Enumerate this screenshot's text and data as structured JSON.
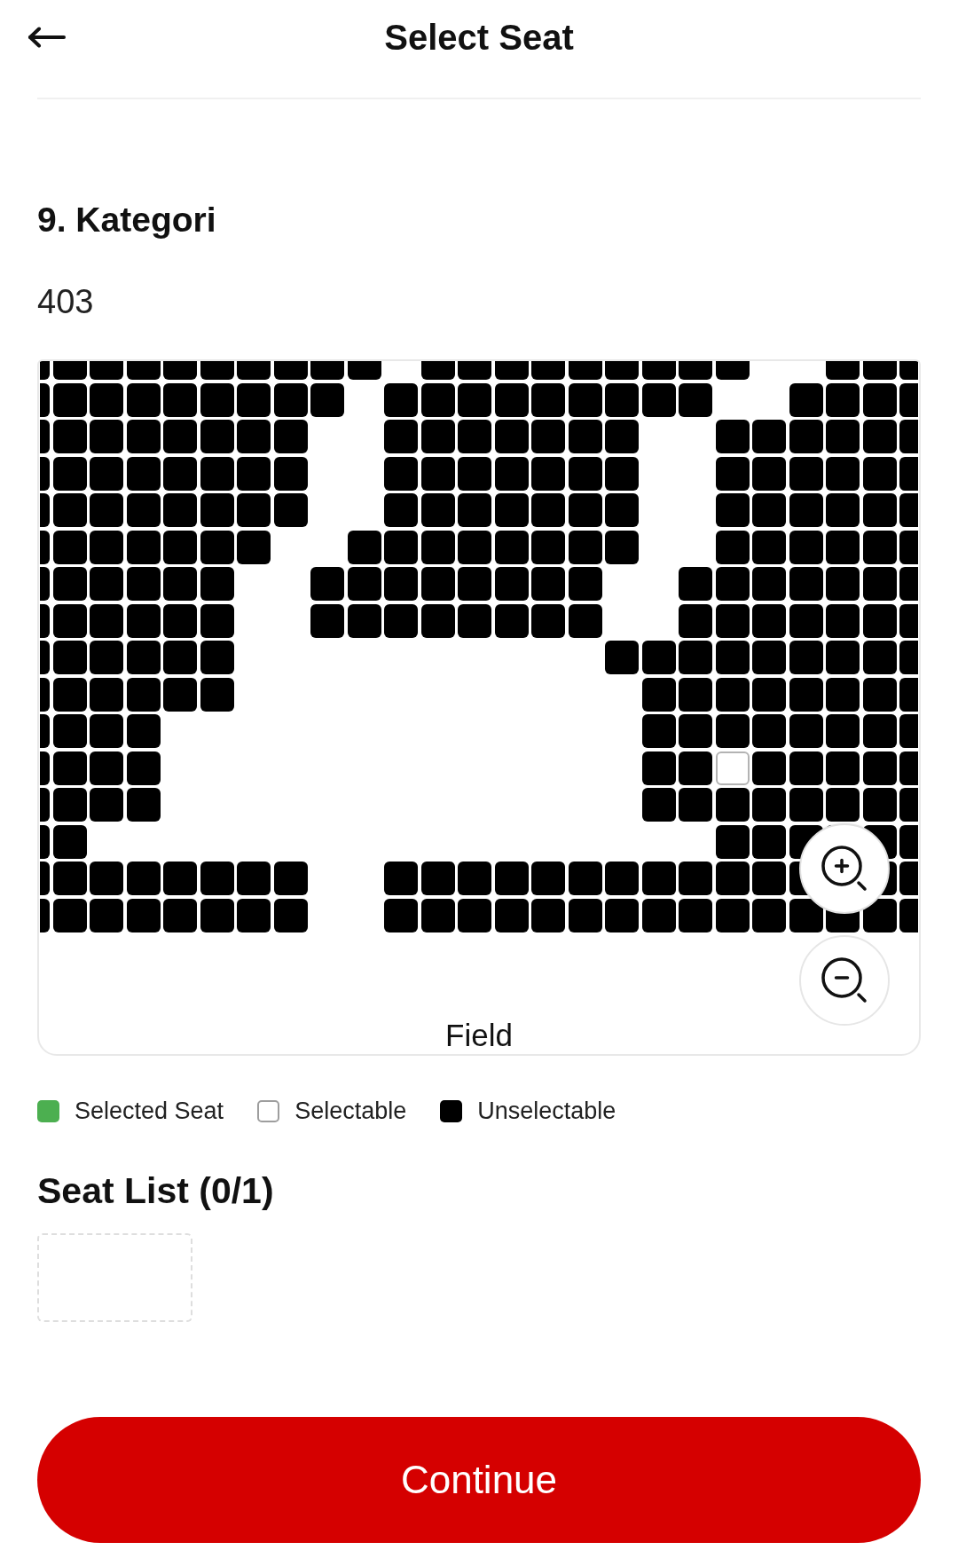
{
  "header": {
    "title": "Select Seat"
  },
  "category": {
    "title": "9. Kategori",
    "section": "403"
  },
  "seat_map": {
    "field_label": "Field",
    "rows": [
      {
        "seats": [
          {
            "kind": "blocked"
          },
          {
            "kind": "blocked"
          },
          {
            "kind": "blocked"
          },
          {
            "kind": "blocked"
          },
          {
            "kind": "blocked"
          },
          {
            "kind": "blocked"
          },
          {
            "kind": "blocked"
          },
          {
            "kind": "blocked"
          },
          {
            "kind": "blocked"
          },
          {
            "kind": "blocked"
          },
          {
            "kind": "gap"
          },
          {
            "kind": "blocked"
          },
          {
            "kind": "blocked"
          },
          {
            "kind": "blocked"
          },
          {
            "kind": "blocked"
          },
          {
            "kind": "blocked"
          },
          {
            "kind": "blocked"
          },
          {
            "kind": "blocked"
          },
          {
            "kind": "blocked"
          },
          {
            "kind": "blocked"
          },
          {
            "kind": "gap"
          },
          {
            "kind": "gap"
          },
          {
            "kind": "blocked"
          },
          {
            "kind": "blocked"
          },
          {
            "kind": "blocked"
          }
        ]
      },
      {
        "seats": [
          {
            "kind": "blocked"
          },
          {
            "kind": "blocked"
          },
          {
            "kind": "blocked"
          },
          {
            "kind": "blocked"
          },
          {
            "kind": "blocked"
          },
          {
            "kind": "blocked"
          },
          {
            "kind": "blocked"
          },
          {
            "kind": "blocked"
          },
          {
            "kind": "blocked"
          },
          {
            "kind": "gap"
          },
          {
            "kind": "blocked"
          },
          {
            "kind": "blocked"
          },
          {
            "kind": "blocked"
          },
          {
            "kind": "blocked"
          },
          {
            "kind": "blocked"
          },
          {
            "kind": "blocked"
          },
          {
            "kind": "blocked"
          },
          {
            "kind": "blocked"
          },
          {
            "kind": "blocked"
          },
          {
            "kind": "gap"
          },
          {
            "kind": "gap"
          },
          {
            "kind": "blocked"
          },
          {
            "kind": "blocked"
          },
          {
            "kind": "blocked"
          },
          {
            "kind": "blocked"
          }
        ]
      },
      {
        "seats": [
          {
            "kind": "blocked"
          },
          {
            "kind": "blocked"
          },
          {
            "kind": "blocked"
          },
          {
            "kind": "blocked"
          },
          {
            "kind": "blocked"
          },
          {
            "kind": "blocked"
          },
          {
            "kind": "blocked"
          },
          {
            "kind": "blocked"
          },
          {
            "kind": "gap"
          },
          {
            "kind": "gap"
          },
          {
            "kind": "blocked"
          },
          {
            "kind": "blocked"
          },
          {
            "kind": "blocked"
          },
          {
            "kind": "blocked"
          },
          {
            "kind": "blocked"
          },
          {
            "kind": "blocked"
          },
          {
            "kind": "blocked"
          },
          {
            "kind": "gap"
          },
          {
            "kind": "gap"
          },
          {
            "kind": "blocked"
          },
          {
            "kind": "blocked"
          },
          {
            "kind": "blocked"
          },
          {
            "kind": "blocked"
          },
          {
            "kind": "blocked"
          },
          {
            "kind": "blocked"
          }
        ]
      },
      {
        "seats": [
          {
            "kind": "blocked"
          },
          {
            "kind": "blocked"
          },
          {
            "kind": "blocked"
          },
          {
            "kind": "blocked"
          },
          {
            "kind": "blocked"
          },
          {
            "kind": "blocked"
          },
          {
            "kind": "blocked"
          },
          {
            "kind": "blocked"
          },
          {
            "kind": "gap"
          },
          {
            "kind": "gap"
          },
          {
            "kind": "blocked"
          },
          {
            "kind": "blocked"
          },
          {
            "kind": "blocked"
          },
          {
            "kind": "blocked"
          },
          {
            "kind": "blocked"
          },
          {
            "kind": "blocked"
          },
          {
            "kind": "blocked"
          },
          {
            "kind": "gap"
          },
          {
            "kind": "gap"
          },
          {
            "kind": "blocked"
          },
          {
            "kind": "blocked"
          },
          {
            "kind": "blocked"
          },
          {
            "kind": "blocked"
          },
          {
            "kind": "blocked"
          },
          {
            "kind": "blocked"
          }
        ]
      },
      {
        "seats": [
          {
            "kind": "blocked"
          },
          {
            "kind": "blocked"
          },
          {
            "kind": "blocked"
          },
          {
            "kind": "blocked"
          },
          {
            "kind": "blocked"
          },
          {
            "kind": "blocked"
          },
          {
            "kind": "blocked"
          },
          {
            "kind": "blocked"
          },
          {
            "kind": "gap"
          },
          {
            "kind": "gap"
          },
          {
            "kind": "blocked"
          },
          {
            "kind": "blocked"
          },
          {
            "kind": "blocked"
          },
          {
            "kind": "blocked"
          },
          {
            "kind": "blocked"
          },
          {
            "kind": "blocked"
          },
          {
            "kind": "blocked"
          },
          {
            "kind": "gap"
          },
          {
            "kind": "gap"
          },
          {
            "kind": "blocked"
          },
          {
            "kind": "blocked"
          },
          {
            "kind": "blocked"
          },
          {
            "kind": "blocked"
          },
          {
            "kind": "blocked"
          },
          {
            "kind": "blocked"
          }
        ]
      },
      {
        "seats": [
          {
            "kind": "blocked"
          },
          {
            "kind": "blocked"
          },
          {
            "kind": "blocked"
          },
          {
            "kind": "blocked"
          },
          {
            "kind": "blocked"
          },
          {
            "kind": "blocked"
          },
          {
            "kind": "blocked"
          },
          {
            "kind": "gap"
          },
          {
            "kind": "gap"
          },
          {
            "kind": "blocked"
          },
          {
            "kind": "blocked"
          },
          {
            "kind": "blocked"
          },
          {
            "kind": "blocked"
          },
          {
            "kind": "blocked"
          },
          {
            "kind": "blocked"
          },
          {
            "kind": "blocked"
          },
          {
            "kind": "blocked"
          },
          {
            "kind": "gap"
          },
          {
            "kind": "gap"
          },
          {
            "kind": "blocked"
          },
          {
            "kind": "blocked"
          },
          {
            "kind": "blocked"
          },
          {
            "kind": "blocked"
          },
          {
            "kind": "blocked"
          },
          {
            "kind": "blocked"
          }
        ]
      },
      {
        "seats": [
          {
            "kind": "blocked"
          },
          {
            "kind": "blocked"
          },
          {
            "kind": "blocked"
          },
          {
            "kind": "blocked"
          },
          {
            "kind": "blocked"
          },
          {
            "kind": "blocked"
          },
          {
            "kind": "gap"
          },
          {
            "kind": "gap"
          },
          {
            "kind": "blocked"
          },
          {
            "kind": "blocked"
          },
          {
            "kind": "blocked"
          },
          {
            "kind": "blocked"
          },
          {
            "kind": "blocked"
          },
          {
            "kind": "blocked"
          },
          {
            "kind": "blocked"
          },
          {
            "kind": "blocked"
          },
          {
            "kind": "gap"
          },
          {
            "kind": "gap"
          },
          {
            "kind": "blocked"
          },
          {
            "kind": "blocked"
          },
          {
            "kind": "blocked"
          },
          {
            "kind": "blocked"
          },
          {
            "kind": "blocked"
          },
          {
            "kind": "blocked"
          },
          {
            "kind": "blocked"
          }
        ]
      },
      {
        "seats": [
          {
            "kind": "blocked"
          },
          {
            "kind": "blocked"
          },
          {
            "kind": "blocked"
          },
          {
            "kind": "blocked"
          },
          {
            "kind": "blocked"
          },
          {
            "kind": "blocked"
          },
          {
            "kind": "gap"
          },
          {
            "kind": "gap"
          },
          {
            "kind": "blocked"
          },
          {
            "kind": "blocked"
          },
          {
            "kind": "blocked"
          },
          {
            "kind": "blocked"
          },
          {
            "kind": "blocked"
          },
          {
            "kind": "blocked"
          },
          {
            "kind": "blocked"
          },
          {
            "kind": "blocked"
          },
          {
            "kind": "gap"
          },
          {
            "kind": "gap"
          },
          {
            "kind": "blocked"
          },
          {
            "kind": "blocked"
          },
          {
            "kind": "blocked"
          },
          {
            "kind": "blocked"
          },
          {
            "kind": "blocked"
          },
          {
            "kind": "blocked"
          },
          {
            "kind": "blocked"
          }
        ]
      },
      {
        "seats": [
          {
            "kind": "blocked"
          },
          {
            "kind": "blocked"
          },
          {
            "kind": "blocked"
          },
          {
            "kind": "blocked"
          },
          {
            "kind": "blocked"
          },
          {
            "kind": "blocked"
          },
          {
            "kind": "gap"
          },
          {
            "kind": "gap"
          },
          {
            "kind": "gap"
          },
          {
            "kind": "gap"
          },
          {
            "kind": "gap"
          },
          {
            "kind": "gap"
          },
          {
            "kind": "gap"
          },
          {
            "kind": "gap"
          },
          {
            "kind": "gap"
          },
          {
            "kind": "gap"
          },
          {
            "kind": "blocked"
          },
          {
            "kind": "blocked"
          },
          {
            "kind": "blocked"
          },
          {
            "kind": "blocked"
          },
          {
            "kind": "blocked"
          },
          {
            "kind": "blocked"
          },
          {
            "kind": "blocked"
          },
          {
            "kind": "blocked"
          },
          {
            "kind": "blocked"
          }
        ]
      },
      {
        "seats": [
          {
            "kind": "blocked"
          },
          {
            "kind": "blocked"
          },
          {
            "kind": "blocked"
          },
          {
            "kind": "blocked"
          },
          {
            "kind": "blocked"
          },
          {
            "kind": "blocked"
          },
          {
            "kind": "gap"
          },
          {
            "kind": "gap"
          },
          {
            "kind": "gap"
          },
          {
            "kind": "gap"
          },
          {
            "kind": "gap"
          },
          {
            "kind": "gap"
          },
          {
            "kind": "gap"
          },
          {
            "kind": "gap"
          },
          {
            "kind": "gap"
          },
          {
            "kind": "gap"
          },
          {
            "kind": "gap"
          },
          {
            "kind": "blocked"
          },
          {
            "kind": "blocked"
          },
          {
            "kind": "blocked"
          },
          {
            "kind": "blocked"
          },
          {
            "kind": "blocked"
          },
          {
            "kind": "blocked"
          },
          {
            "kind": "blocked"
          },
          {
            "kind": "blocked"
          }
        ]
      },
      {
        "seats": [
          {
            "kind": "blocked"
          },
          {
            "kind": "blocked"
          },
          {
            "kind": "blocked"
          },
          {
            "kind": "blocked"
          },
          {
            "kind": "gap"
          },
          {
            "kind": "gap"
          },
          {
            "kind": "gap"
          },
          {
            "kind": "gap"
          },
          {
            "kind": "gap"
          },
          {
            "kind": "gap"
          },
          {
            "kind": "gap"
          },
          {
            "kind": "gap"
          },
          {
            "kind": "gap"
          },
          {
            "kind": "gap"
          },
          {
            "kind": "gap"
          },
          {
            "kind": "gap"
          },
          {
            "kind": "gap"
          },
          {
            "kind": "blocked"
          },
          {
            "kind": "blocked"
          },
          {
            "kind": "blocked"
          },
          {
            "kind": "blocked"
          },
          {
            "kind": "blocked"
          },
          {
            "kind": "blocked"
          },
          {
            "kind": "blocked"
          },
          {
            "kind": "blocked"
          }
        ]
      },
      {
        "seats": [
          {
            "kind": "blocked"
          },
          {
            "kind": "blocked"
          },
          {
            "kind": "blocked"
          },
          {
            "kind": "blocked"
          },
          {
            "kind": "gap"
          },
          {
            "kind": "gap"
          },
          {
            "kind": "gap"
          },
          {
            "kind": "gap"
          },
          {
            "kind": "gap"
          },
          {
            "kind": "gap"
          },
          {
            "kind": "gap"
          },
          {
            "kind": "gap"
          },
          {
            "kind": "gap"
          },
          {
            "kind": "gap"
          },
          {
            "kind": "gap"
          },
          {
            "kind": "gap"
          },
          {
            "kind": "gap"
          },
          {
            "kind": "blocked"
          },
          {
            "kind": "blocked"
          },
          {
            "kind": "open"
          },
          {
            "kind": "blocked"
          },
          {
            "kind": "blocked"
          },
          {
            "kind": "blocked"
          },
          {
            "kind": "blocked"
          },
          {
            "kind": "blocked"
          }
        ]
      },
      {
        "seats": [
          {
            "kind": "blocked"
          },
          {
            "kind": "blocked"
          },
          {
            "kind": "blocked"
          },
          {
            "kind": "blocked"
          },
          {
            "kind": "gap"
          },
          {
            "kind": "gap"
          },
          {
            "kind": "gap"
          },
          {
            "kind": "gap"
          },
          {
            "kind": "gap"
          },
          {
            "kind": "gap"
          },
          {
            "kind": "gap"
          },
          {
            "kind": "gap"
          },
          {
            "kind": "gap"
          },
          {
            "kind": "gap"
          },
          {
            "kind": "gap"
          },
          {
            "kind": "gap"
          },
          {
            "kind": "gap"
          },
          {
            "kind": "blocked"
          },
          {
            "kind": "blocked"
          },
          {
            "kind": "blocked"
          },
          {
            "kind": "blocked"
          },
          {
            "kind": "blocked"
          },
          {
            "kind": "blocked"
          },
          {
            "kind": "blocked"
          },
          {
            "kind": "blocked"
          }
        ]
      },
      {
        "seats": [
          {
            "kind": "blocked"
          },
          {
            "kind": "blocked"
          },
          {
            "kind": "gap"
          },
          {
            "kind": "gap"
          },
          {
            "kind": "gap"
          },
          {
            "kind": "gap"
          },
          {
            "kind": "gap"
          },
          {
            "kind": "gap"
          },
          {
            "kind": "gap"
          },
          {
            "kind": "gap"
          },
          {
            "kind": "gap"
          },
          {
            "kind": "gap"
          },
          {
            "kind": "gap"
          },
          {
            "kind": "gap"
          },
          {
            "kind": "gap"
          },
          {
            "kind": "gap"
          },
          {
            "kind": "gap"
          },
          {
            "kind": "gap"
          },
          {
            "kind": "gap"
          },
          {
            "kind": "blocked"
          },
          {
            "kind": "blocked"
          },
          {
            "kind": "blocked"
          },
          {
            "kind": "blocked"
          },
          {
            "kind": "blocked"
          },
          {
            "kind": "blocked"
          }
        ]
      },
      {
        "seats": [
          {
            "kind": "blocked"
          },
          {
            "kind": "blocked"
          },
          {
            "kind": "blocked"
          },
          {
            "kind": "blocked"
          },
          {
            "kind": "blocked"
          },
          {
            "kind": "blocked"
          },
          {
            "kind": "blocked"
          },
          {
            "kind": "blocked"
          },
          {
            "kind": "gap"
          },
          {
            "kind": "gap"
          },
          {
            "kind": "blocked"
          },
          {
            "kind": "blocked"
          },
          {
            "kind": "blocked"
          },
          {
            "kind": "blocked"
          },
          {
            "kind": "blocked"
          },
          {
            "kind": "blocked"
          },
          {
            "kind": "blocked"
          },
          {
            "kind": "blocked"
          },
          {
            "kind": "blocked"
          },
          {
            "kind": "blocked"
          },
          {
            "kind": "blocked"
          },
          {
            "kind": "blocked"
          },
          {
            "kind": "gap"
          },
          {
            "kind": "blocked"
          },
          {
            "kind": "blocked"
          }
        ]
      },
      {
        "seats": [
          {
            "kind": "blocked"
          },
          {
            "kind": "blocked"
          },
          {
            "kind": "blocked"
          },
          {
            "kind": "blocked"
          },
          {
            "kind": "blocked"
          },
          {
            "kind": "blocked"
          },
          {
            "kind": "blocked"
          },
          {
            "kind": "blocked"
          },
          {
            "kind": "gap"
          },
          {
            "kind": "gap"
          },
          {
            "kind": "blocked"
          },
          {
            "kind": "blocked"
          },
          {
            "kind": "blocked"
          },
          {
            "kind": "blocked"
          },
          {
            "kind": "blocked"
          },
          {
            "kind": "blocked"
          },
          {
            "kind": "blocked"
          },
          {
            "kind": "blocked"
          },
          {
            "kind": "blocked"
          },
          {
            "kind": "blocked"
          },
          {
            "kind": "blocked"
          },
          {
            "kind": "blocked"
          },
          {
            "kind": "blocked"
          },
          {
            "kind": "blocked"
          },
          {
            "kind": "blocked"
          }
        ]
      }
    ]
  },
  "legend": [
    {
      "kind": "selected",
      "label": "Selected Seat"
    },
    {
      "kind": "open",
      "label": "Selectable"
    },
    {
      "kind": "blocked",
      "label": "Unselectable"
    }
  ],
  "seat_list": {
    "title": "Seat List (0/1)",
    "slots": [
      {
        "kind": "empty"
      }
    ]
  },
  "continue_button": {
    "label": "Continue"
  }
}
